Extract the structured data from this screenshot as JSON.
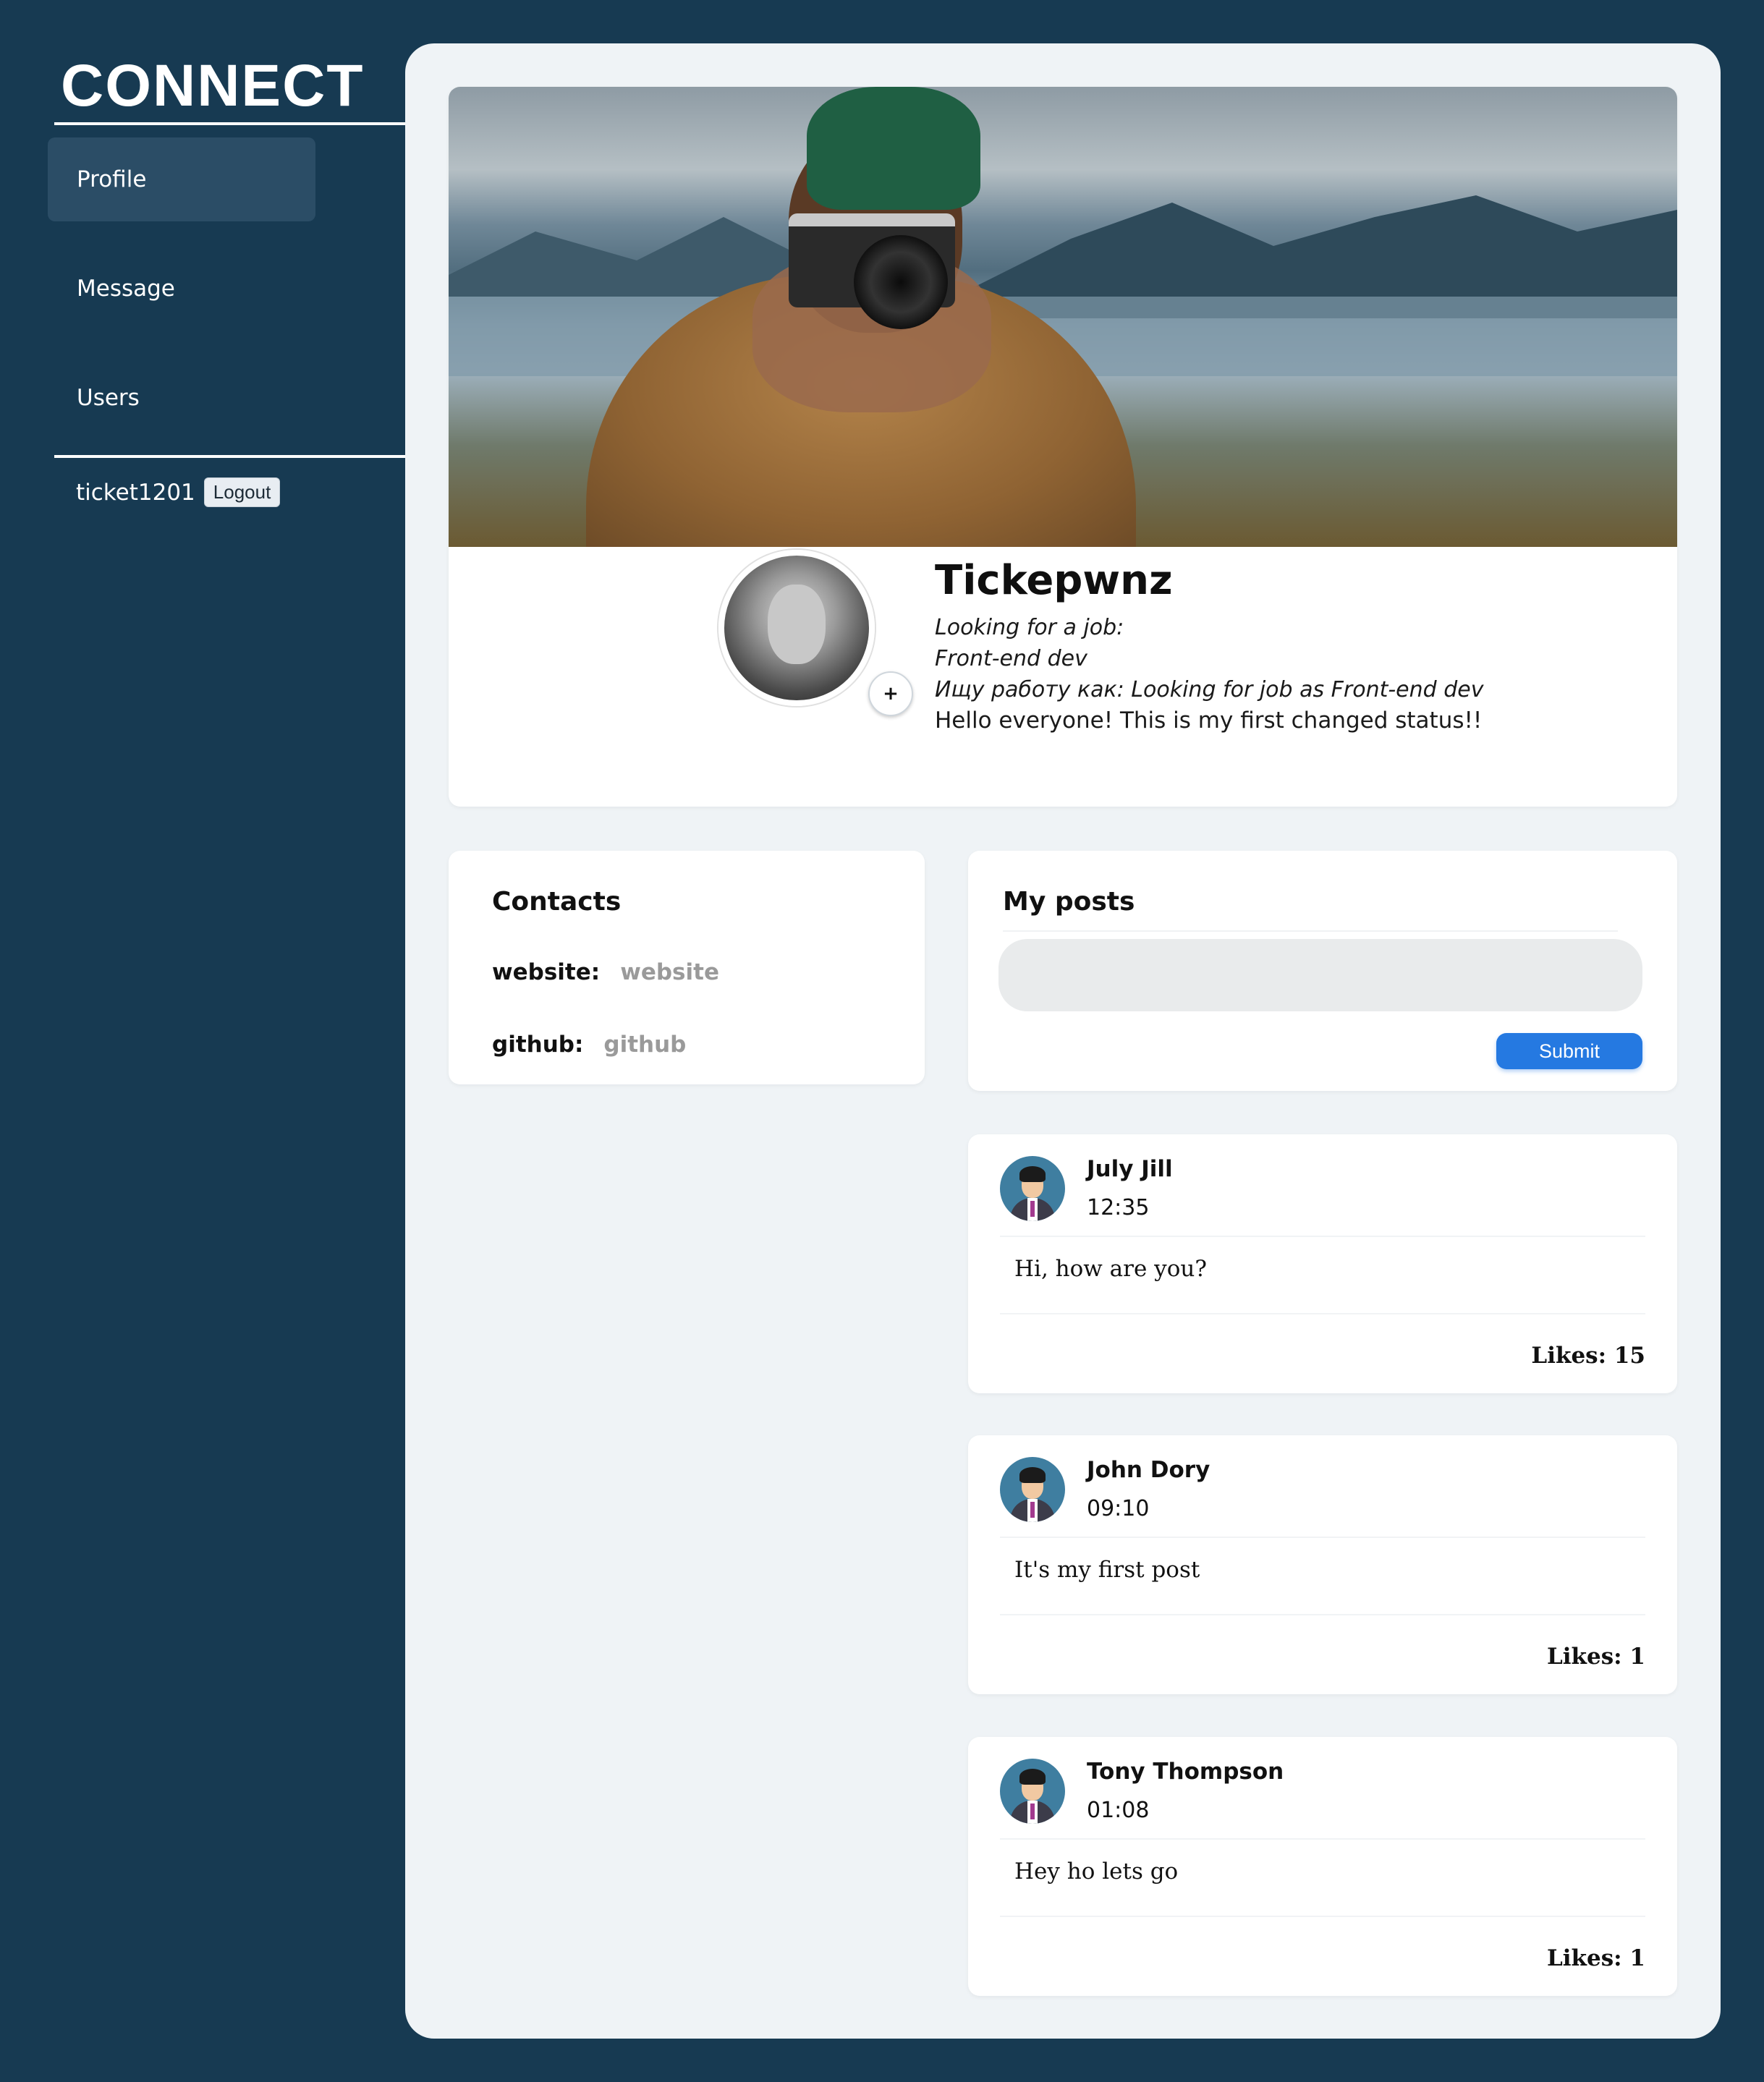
{
  "sidebar": {
    "logo": "CONNECT",
    "nav": [
      {
        "label": "Profile"
      },
      {
        "label": "Message"
      },
      {
        "label": "Users"
      }
    ],
    "username": "ticket1201",
    "logout_label": "Logout"
  },
  "profile": {
    "name": "Tickepwnz",
    "looking_for_job": "Looking for a job:",
    "job_title": "Front-end dev",
    "job_description": "Ищу работу как: Looking for job as Front-end dev",
    "status": "Hello everyone! This is my first changed status!!",
    "add_photo_symbol": "+"
  },
  "contacts": {
    "title": "Contacts",
    "items": [
      {
        "label": "website:",
        "value": "website"
      },
      {
        "label": "github:",
        "value": "github"
      }
    ]
  },
  "my_posts": {
    "title": "My posts",
    "input_value": "",
    "submit_label": "Submit"
  },
  "posts": [
    {
      "author": "July Jill",
      "time": "12:35",
      "text": "Hi, how are you?",
      "likes": "Likes: 15"
    },
    {
      "author": "John Dory",
      "time": "09:10",
      "text": "It's my first post",
      "likes": "Likes: 1"
    },
    {
      "author": "Tony Thompson",
      "time": "01:08",
      "text": "Hey ho lets go",
      "likes": "Likes: 1"
    }
  ],
  "colors": {
    "background": "#173a52",
    "panel": "#eff3f6",
    "nav_active": "#2b4d66",
    "submit": "#2579e1"
  },
  "icons": {
    "avatar_post": "user-avatar-icon",
    "add_photo": "plus-icon"
  }
}
